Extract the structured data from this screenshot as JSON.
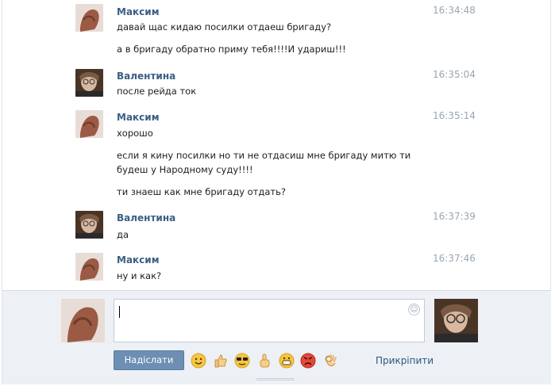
{
  "messages": [
    {
      "sender": "Максим",
      "time": "16:34:48",
      "avatar": "maxim-avatar",
      "lines": [
        "давай щас кидаю посилки отдаеш бригаду?",
        "а в бригаду обратно приму тебя!!!!И удариш!!!"
      ]
    },
    {
      "sender": "Валентина",
      "time": "16:35:04",
      "avatar": "valentina-avatar",
      "lines": [
        "после рейда ток"
      ]
    },
    {
      "sender": "Максим",
      "time": "16:35:14",
      "avatar": "maxim-avatar",
      "lines": [
        "хорошо",
        "если я кину посилки но ти не отдасиш мне бригаду митю ти",
        "будеш у Народному суду!!!!",
        "ти знаеш как мне бригаду отдать?"
      ]
    },
    {
      "sender": "Валентина",
      "time": "16:37:39",
      "avatar": "valentina-avatar",
      "lines": [
        "да"
      ]
    },
    {
      "sender": "Максим",
      "time": "16:37:46",
      "avatar": "maxim-avatar",
      "lines": [
        "ну и как?"
      ]
    }
  ],
  "composer": {
    "input_value": "",
    "send_label": "Надіслати",
    "attach_label": "Прикріпити",
    "emojis": [
      "smile",
      "thumbs-up",
      "sunglasses",
      "pointing-finger",
      "grin",
      "angry",
      "ok-hand"
    ]
  }
}
